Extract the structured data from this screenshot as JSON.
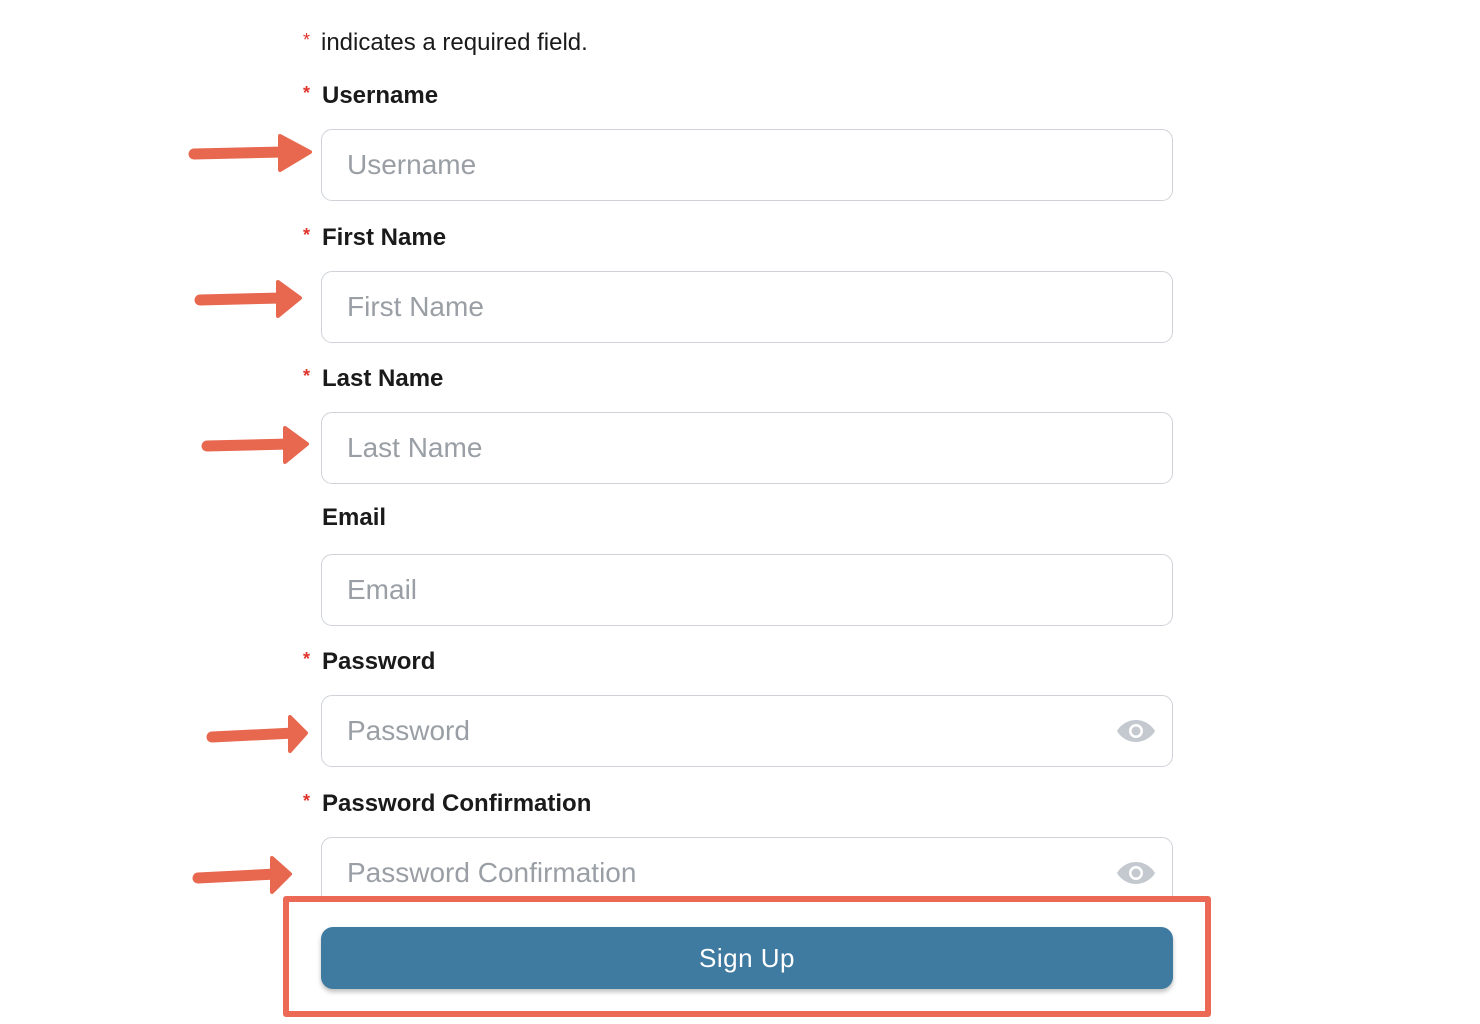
{
  "required_note": {
    "marker": "*",
    "text": "indicates a required field."
  },
  "fields": {
    "username": {
      "label": "Username",
      "placeholder": "Username",
      "required_marker": "*"
    },
    "first_name": {
      "label": "First Name",
      "placeholder": "First Name",
      "required_marker": "*"
    },
    "last_name": {
      "label": "Last Name",
      "placeholder": "Last Name",
      "required_marker": "*"
    },
    "email": {
      "label": "Email",
      "placeholder": "Email"
    },
    "password": {
      "label": "Password",
      "placeholder": "Password",
      "required_marker": "*",
      "toggle_icon": "eye-icon"
    },
    "password_confirmation": {
      "label": "Password Confirmation",
      "placeholder": "Password Confirmation",
      "required_marker": "*",
      "toggle_icon": "eye-icon"
    }
  },
  "signup_button": {
    "label": "Sign Up"
  },
  "annotations": {
    "arrow_icon": "right-arrow-icon",
    "arrow_color": "#e8674f",
    "highlight_color": "#ec6a55"
  },
  "colors": {
    "required_star": "#e0332b",
    "button_bg": "#3f7aa0",
    "input_border": "#cfd3d8",
    "placeholder": "#9a9fa5"
  }
}
